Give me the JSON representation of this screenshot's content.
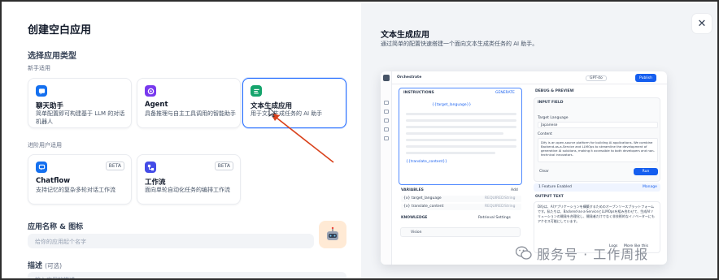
{
  "left": {
    "title": "创建空白应用",
    "app_type_label": "选择应用类型",
    "beginner_label": "新手适用",
    "advanced_label": "进阶用户适用",
    "cards": [
      {
        "name": "聊天助手",
        "desc": "简单配置即可构建基于 LLM 的对话机器人",
        "icon": "chat-bubble-icon",
        "color": "#1570ef"
      },
      {
        "name": "Agent",
        "desc": "具备推理与自主工具调用的智能助手",
        "icon": "agent-icon",
        "color": "#7839ee"
      },
      {
        "name": "文本生成应用",
        "desc": "用于文本生成任务的 AI 助手",
        "icon": "text-generator-icon",
        "color": "#15a46c"
      },
      {
        "name": "Chatflow",
        "desc": "支持记忆的复杂多轮对话工作流",
        "icon": "chatflow-icon",
        "color": "#1570ef",
        "badge": "BETA"
      },
      {
        "name": "工作流",
        "desc": "面向单轮自动化任务的编排工作流",
        "icon": "workflow-icon",
        "color": "#444ce7",
        "badge": "BETA"
      }
    ],
    "name_icon_label": "应用名称 & 图标",
    "name_placeholder": "给你的应用起个名字",
    "desc_label": "描述",
    "desc_optional": "(可选)",
    "desc_placeholder": "输入应用的描述"
  },
  "right": {
    "title": "文本生成应用",
    "desc": "通过简单的配置快速搭建一个面向文本生成类任务的 AI 助手。",
    "mock": {
      "orchestrate": "Orchestrate",
      "model": "GPT-4o",
      "publish": "Publish",
      "instructions": "INSTRUCTIONS",
      "generate": "GENERATE",
      "var1": "{{target_language}}",
      "var2": "{{translate_content}}",
      "variables": "VARIABLES",
      "add": "Add",
      "vars": [
        {
          "key": "{x} target_language",
          "req": "REQUIRED",
          "type": "String"
        },
        {
          "key": "{x} translate_content",
          "req": "REQUIRED",
          "type": "String"
        }
      ],
      "knowledge": "KNOWLEDGE",
      "retrieval": "Retrieval Settings",
      "vision": "Vision",
      "debug": "DEBUG & PREVIEW",
      "input_field": "INPUT FIELD",
      "target_language": "Target Language",
      "japanese": "Japanese",
      "content": "Content",
      "content_text": "Dify is an open-source platform for building AI applications. We combine Backend-as-a-Service and LLMOps to streamline the development of generative AI solutions, making it accessible to both developers and non-technical innovators.",
      "clear": "Clear",
      "run": "Run",
      "output_text": "OUTPUT TEXT",
      "output": "Difyは、AIアプリケーションを構築するためのオープンソースプラットフォームです。私たちは、Backend-as-a-ServiceとLLMOpsを組み合わせて、生成AIソリューションの開発を合理化し、開発者だけでなく非技術的なイノベーターにもアクセス可能にしています。",
      "features": "1 Feature Enabled",
      "manage": "Manage",
      "logs": "Logs",
      "more_like": "More like this"
    }
  },
  "watermark": "服务号 · 工作周报"
}
